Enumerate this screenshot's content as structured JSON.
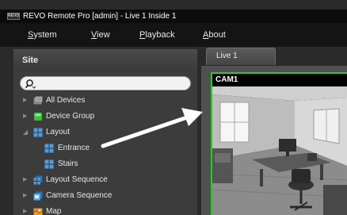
{
  "window": {
    "title": "REVO Remote Pro [admin] - Live 1  Inside 1",
    "app_icon_text": "REVO"
  },
  "menu": {
    "items": [
      {
        "label": "System",
        "mnemonic": "S",
        "rest": "ystem"
      },
      {
        "label": "View",
        "mnemonic": "V",
        "rest": "iew"
      },
      {
        "label": "Playback",
        "mnemonic": "P",
        "rest": "layback"
      },
      {
        "label": "About",
        "mnemonic": "A",
        "rest": "bout"
      }
    ]
  },
  "site_panel": {
    "header": "Site",
    "search": {
      "value": "",
      "placeholder": ""
    },
    "tree": [
      {
        "label": "All Devices",
        "icon": "all-devices-icon",
        "expanded": false
      },
      {
        "label": "Device Group",
        "icon": "device-group-icon",
        "expanded": false
      },
      {
        "label": "Layout",
        "icon": "layout-icon",
        "expanded": true
      },
      {
        "label": "Entrance",
        "icon": "layout-icon"
      },
      {
        "label": "Stairs",
        "icon": "layout-icon"
      },
      {
        "label": "Layout Sequence",
        "icon": "layout-sequence-icon",
        "expanded": false
      },
      {
        "label": "Camera Sequence",
        "icon": "camera-sequence-icon",
        "expanded": false
      },
      {
        "label": "Map",
        "icon": "map-icon",
        "expanded": false
      }
    ]
  },
  "live": {
    "tab_label": "Live  1",
    "camera": {
      "title": "CAM1"
    }
  },
  "colors": {
    "selection_border": "#1fd11f",
    "panel_bg": "#3c3c3c",
    "menubar_bg": "#141414",
    "tree_layout_icon": "#4a9de0",
    "tree_group_icon": "#35c23a"
  }
}
